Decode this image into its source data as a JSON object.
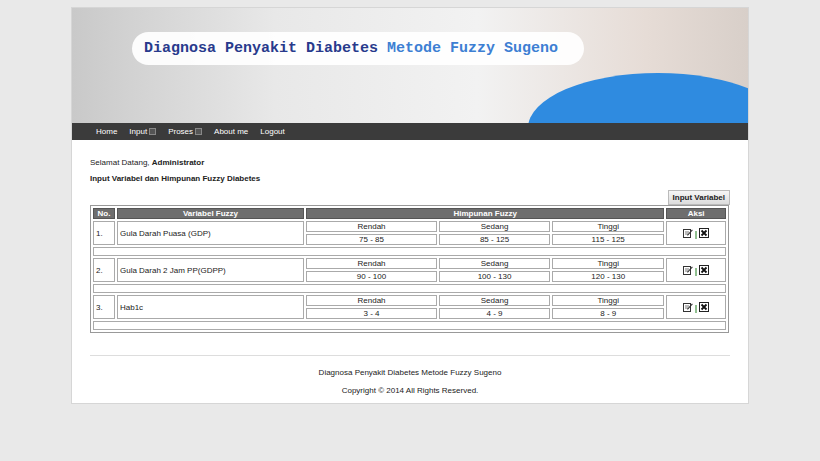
{
  "header": {
    "title_part1": "Diagnosa Penyakit Diabetes",
    "title_part2": "Metode Fuzzy Sugeno"
  },
  "nav": [
    {
      "label": "Home",
      "has_dropdown": false
    },
    {
      "label": "Input",
      "has_dropdown": true
    },
    {
      "label": "Proses",
      "has_dropdown": true
    },
    {
      "label": "About me",
      "has_dropdown": false
    },
    {
      "label": "Logout",
      "has_dropdown": false
    }
  ],
  "welcome": {
    "greeting": "Selamat Datang,",
    "user": "Administrator"
  },
  "page_title": "Input Variabel dan Himpunan Fuzzy Diabetes",
  "add_button": "Input Variabel",
  "table": {
    "columns": [
      "No.",
      "Variabel Fuzzy",
      "Himpunan Fuzzy",
      "Aksi"
    ],
    "rows": [
      {
        "no": "1.",
        "variable": "Gula Darah Puasa (GDP)",
        "sets": [
          {
            "label": "Rendah",
            "range": "75 - 85"
          },
          {
            "label": "Sedang",
            "range": "85 - 125"
          },
          {
            "label": "Tinggi",
            "range": "115 - 125"
          }
        ]
      },
      {
        "no": "2.",
        "variable": "Gula Darah 2 Jam PP(GDPP)",
        "sets": [
          {
            "label": "Rendah",
            "range": "90 - 100"
          },
          {
            "label": "Sedang",
            "range": "100 - 130"
          },
          {
            "label": "Tinggi",
            "range": "120 - 130"
          }
        ]
      },
      {
        "no": "3.",
        "variable": "Hab1c",
        "sets": [
          {
            "label": "Rendah",
            "range": "3 - 4"
          },
          {
            "label": "Sedang",
            "range": "4 - 9"
          },
          {
            "label": "Tinggi",
            "range": "8 - 9"
          }
        ]
      }
    ]
  },
  "footer": {
    "title": "Diagnosa Penyakit Diabetes Metode Fuzzy Sugeno",
    "copyright": "Copyright © 2014 All Rights Reserved."
  }
}
